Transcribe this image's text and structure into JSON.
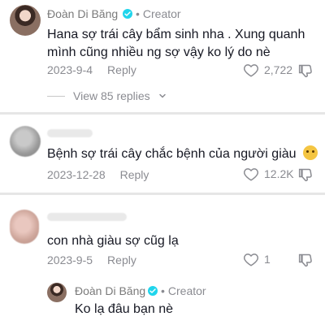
{
  "threads": {
    "c1": {
      "username": "Đoàn Di Băng",
      "badge_label": "Creator",
      "text_line1": "Hana sợ trái cây bẩm sinh nha . Xung quanh",
      "text_line2": "mình cũng nhiều ng sợ vậy ko lý do nè",
      "date": "2023-9-4",
      "reply_label": "Reply",
      "likes": "2,722",
      "view_replies": "View 85 replies",
      "icons": {
        "like": "heart-outline-icon",
        "dislike": "thumb-down-outline-icon",
        "chevron": "chevron-down-icon"
      }
    },
    "c2": {
      "text": "Bệnh sợ trái cây chắc bệnh của người giàu",
      "emoji": "crying-face-emoji",
      "date": "2023-12-28",
      "reply_label": "Reply",
      "likes": "12.2K"
    },
    "c3": {
      "text": "con nhà giàu sợ cũg lạ",
      "date": "2023-9-5",
      "reply_label": "Reply",
      "likes": "1"
    },
    "c4": {
      "username": "Đoàn Di Băng",
      "badge_label": "Creator",
      "text": "Ko lạ đâu bạn nè"
    }
  },
  "colors": {
    "text": "#161823",
    "muted": "#8a8b91",
    "verified": "#20d5ec",
    "separator": "#e6e6e6"
  }
}
